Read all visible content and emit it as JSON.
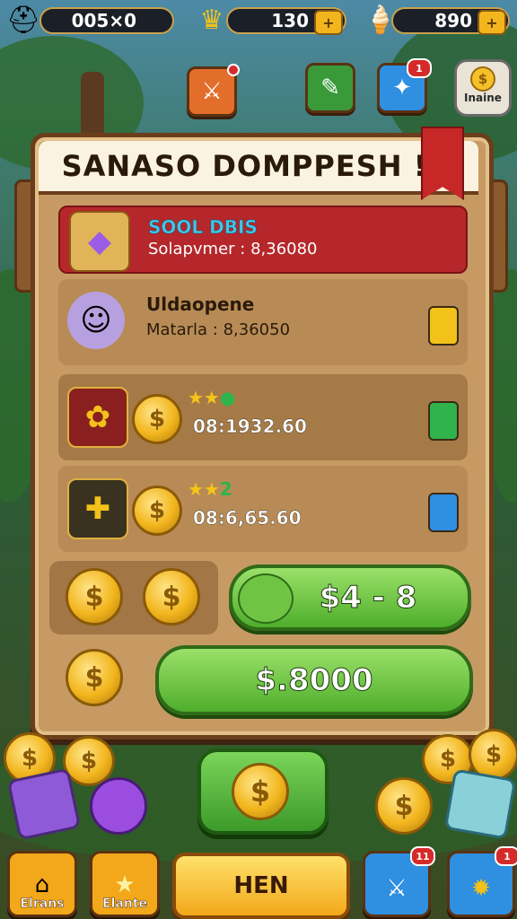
{
  "top_bar": {
    "resource1": "005×0",
    "resource2": "130",
    "resource3": "890",
    "plus_label": "+"
  },
  "quick_buttons": {
    "badge_blue": "1",
    "name_label": "Inaine",
    "name_coin_symbol": "$"
  },
  "panel": {
    "title": "SANASO DOMPPESH !!!",
    "rows": [
      {
        "title": "SOOL DBIS",
        "subtitle": "Solapvmer : 8,36080",
        "title_color": "#3ec7e8"
      },
      {
        "title": "Uldaopene",
        "subtitle": "Matarla : 8,36050",
        "button_color": "#f2c21a"
      },
      {
        "stars": "★★",
        "dot": "●",
        "time": "08:1932.60",
        "button_color": "#2fb34a"
      },
      {
        "stars": "★★",
        "dot": "2",
        "time": "08:6,65.60",
        "button_color": "#2f8fe0"
      }
    ],
    "coin_symbol": "$",
    "green_button_1": "$4 - 8",
    "green_button_2": "$.8000"
  },
  "bottom_bar": {
    "left_btn_1": "Elrans",
    "left_btn_2": "Elante",
    "main_button": "HEN",
    "right_badge": "11",
    "right_badge_2": "1"
  },
  "colors": {
    "accent_gold": "#f2b51d",
    "panel_wood": "#c79a63",
    "row_red": "#b5272a",
    "button_green": "#4fae2c"
  }
}
